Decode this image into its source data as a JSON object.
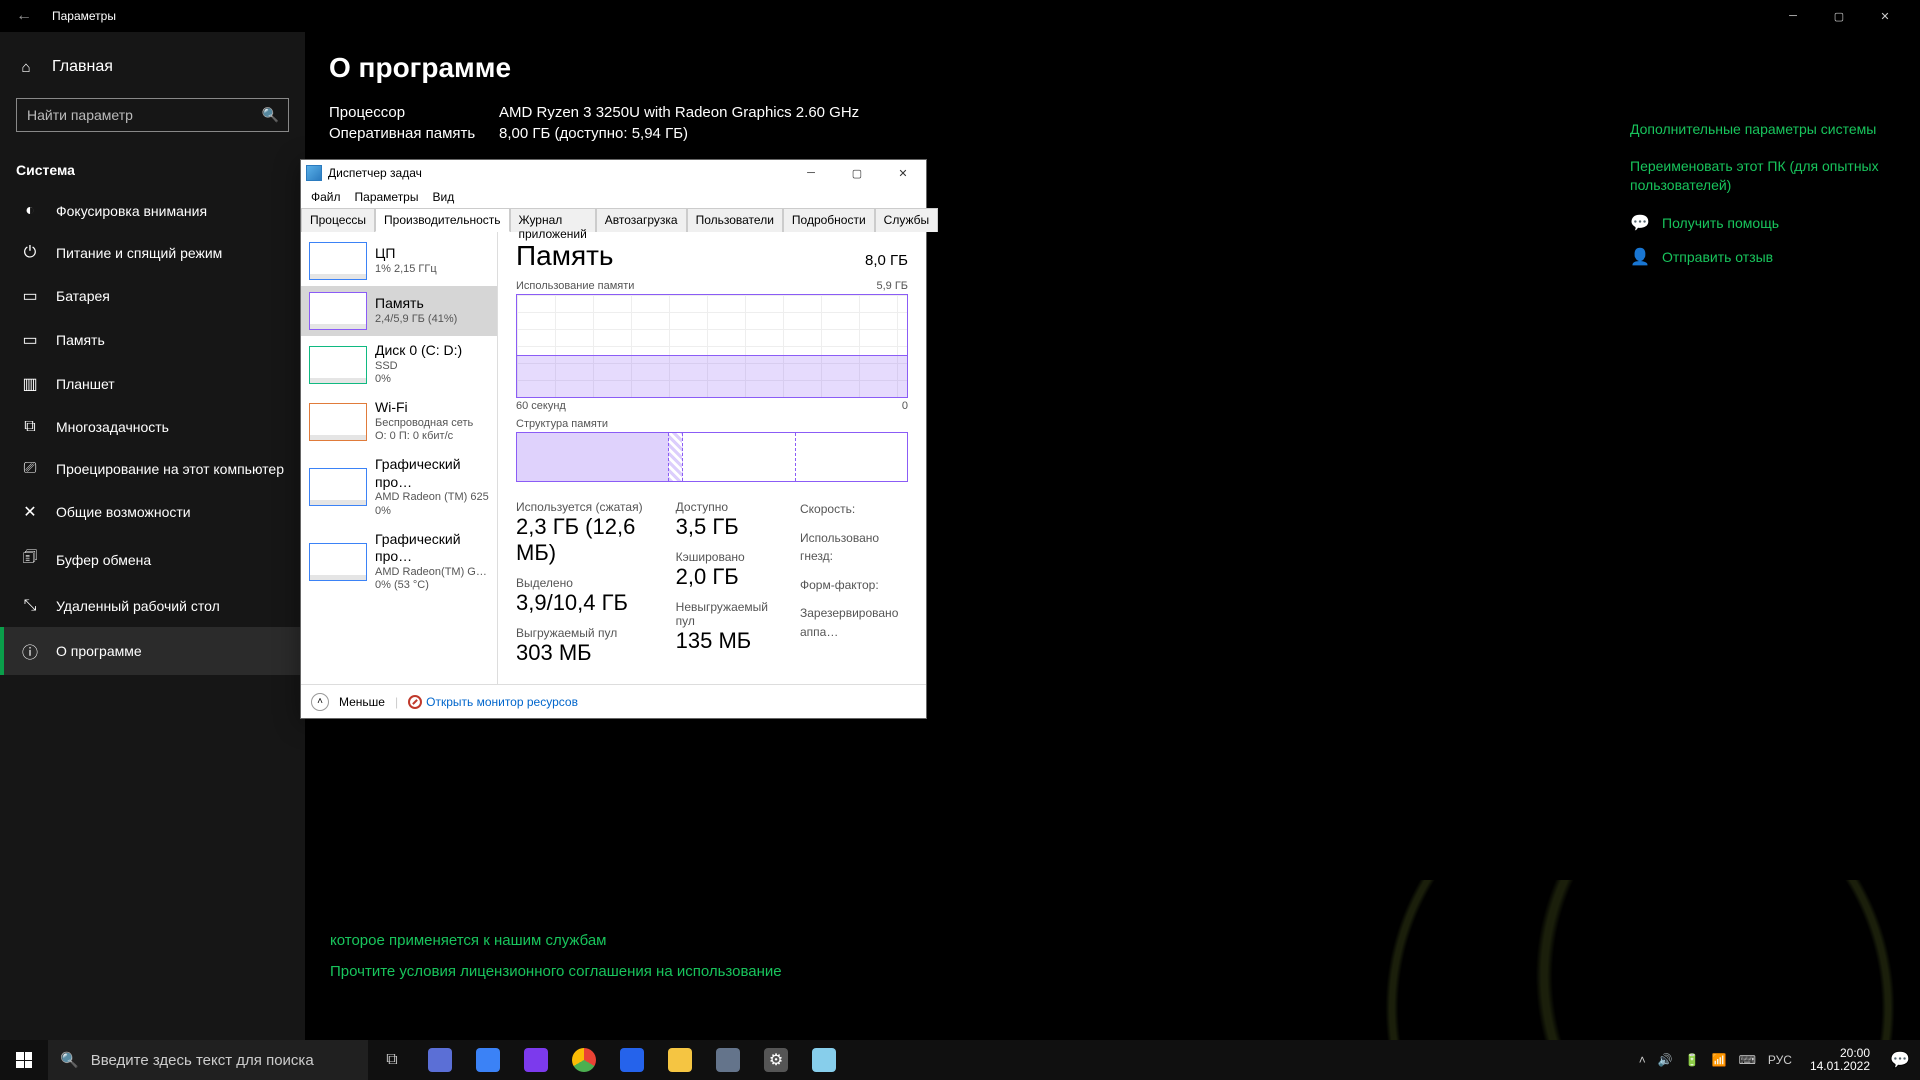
{
  "settings": {
    "titlebar": {
      "title": "Параметры"
    },
    "sidebar": {
      "home": "Главная",
      "search_placeholder": "Найти параметр",
      "category": "Система",
      "items": [
        {
          "icon": "◐",
          "label": "Фокусировка внимания"
        },
        {
          "icon": "⏻",
          "label": "Питание и спящий режим"
        },
        {
          "icon": "▭",
          "label": "Батарея"
        },
        {
          "icon": "▭",
          "label": "Память"
        },
        {
          "icon": "▥",
          "label": "Планшет"
        },
        {
          "icon": "⧉",
          "label": "Многозадачность"
        },
        {
          "icon": "⎚",
          "label": "Проецирование на этот компьютер"
        },
        {
          "icon": "✕",
          "label": "Общие возможности"
        },
        {
          "icon": "🗊",
          "label": "Буфер обмена"
        },
        {
          "icon": "⤡",
          "label": "Удаленный рабочий стол"
        },
        {
          "icon": "ⓘ",
          "label": "О программе"
        }
      ]
    },
    "content": {
      "heading": "О программе",
      "specs": {
        "cpu_label": "Процессор",
        "cpu_value": "AMD Ryzen 3 3250U with Radeon Graphics    2.60 GHz",
        "ram_label": "Оперативная память",
        "ram_value": "8,00 ГБ (доступно: 5,94 ГБ)"
      },
      "links": {
        "adv": "Дополнительные параметры системы",
        "rename": "Переименовать этот ПК (для опытных пользователей)",
        "help": "Получить помощь",
        "feedback": "Отправить отзыв"
      },
      "bottom_text_1": "которое применяется к нашим службам",
      "bottom_text_2": "Прочтите условия лицензионного соглашения на использование"
    }
  },
  "tm": {
    "title": "Диспетчер задач",
    "menu": {
      "file": "Файл",
      "options": "Параметры",
      "view": "Вид"
    },
    "tabs": [
      "Процессы",
      "Производительность",
      "Журнал приложений",
      "Автозагрузка",
      "Пользователи",
      "Подробности",
      "Службы"
    ],
    "active_tab": 1,
    "resources": [
      {
        "name": "ЦП",
        "sub": "1%  2,15 ГГц",
        "kind": "cpu"
      },
      {
        "name": "Память",
        "sub": "2,4/5,9 ГБ (41%)",
        "kind": "mem"
      },
      {
        "name": "Диск 0 (C: D:)",
        "sub": "SSD",
        "sub2": "0%",
        "kind": "disk"
      },
      {
        "name": "Wi-Fi",
        "sub": "Беспроводная сеть",
        "sub2": "О: 0  П: 0 кбит/с",
        "kind": "wifi"
      },
      {
        "name": "Графический про…",
        "sub": "AMD Radeon (TM) 625",
        "sub2": "0%",
        "kind": "gpu"
      },
      {
        "name": "Графический про…",
        "sub": "AMD Radeon(TM) Grap…",
        "sub2": "0%  (53 °C)",
        "kind": "gpu"
      }
    ],
    "detail": {
      "title": "Память",
      "capacity": "8,0 ГБ",
      "usage_label": "Использование памяти",
      "usage_max": "5,9 ГБ",
      "axis_left": "60 секунд",
      "axis_right": "0",
      "comp_label": "Структура памяти",
      "stats": {
        "inuse_lab": "Используется (сжатая)",
        "inuse_val": "2,3 ГБ (12,6 МБ)",
        "avail_lab": "Доступно",
        "avail_val": "3,5 ГБ",
        "commit_lab": "Выделено",
        "commit_val": "3,9/10,4 ГБ",
        "cached_lab": "Кэшировано",
        "cached_val": "2,0 ГБ",
        "paged_lab": "Выгружаемый пул",
        "paged_val": "303 МБ",
        "nonpaged_lab": "Невыгружаемый пул",
        "nonpaged_val": "135 МБ",
        "speed_lab": "Скорость:",
        "slots_lab": "Использовано гнезд:",
        "form_lab": "Форм-фактор:",
        "reserved_lab": "Зарезервировано аппа…"
      }
    },
    "footer": {
      "less": "Меньше",
      "resmon": "Открыть монитор ресурсов"
    }
  },
  "taskbar": {
    "search_placeholder": "Введите здесь текст для поиска",
    "tray": {
      "lang": "РУС"
    },
    "clock": {
      "time": "20:00",
      "date": "14.01.2022"
    }
  }
}
